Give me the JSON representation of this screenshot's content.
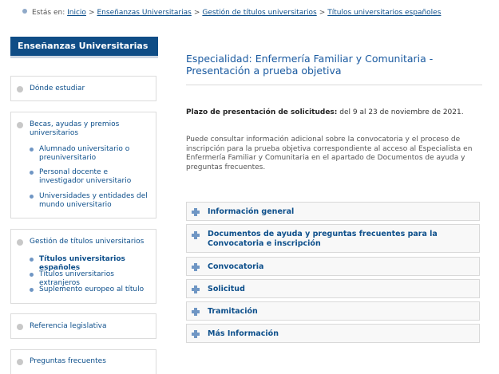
{
  "breadcrumb": {
    "prefix": "Estás en:",
    "items": [
      "Inicio",
      "Enseñanzas Universitarias",
      "Gestión de títulos universitarios",
      "Títulos universitarios españoles"
    ],
    "separator": ">"
  },
  "sidebar": {
    "title": "Enseñanzas Universitarias",
    "donde": "Dónde estudiar",
    "becas": {
      "label": "Becas, ayudas y premios universitarios",
      "subs": [
        "Alumnado universitario o preuniversitario",
        "Personal docente e investigador universitario",
        "Universidades y entidades del mundo universitario"
      ]
    },
    "gestion": {
      "label": "Gestión de títulos universitarios",
      "subs": [
        "Títulos universitarios españoles",
        "Títulos universitarios extranjeros",
        "Suplemento europeo al título"
      ]
    },
    "referencia": "Referencia legislativa",
    "preguntas": "Preguntas frecuentes"
  },
  "main": {
    "title": "Especialidad: Enfermería Familiar y Comunitaria - Presentación a prueba objetiva",
    "plazo_label": "Plazo de presentación de solicitudes:",
    "plazo_value": " del 9 al 23 de noviembre de 2021.",
    "info": "Puede consultar información adicional sobre la convocatoria y el proceso de inscripción para la prueba objetiva correspondiente al acceso al Especialista en Enfermería Familiar y Comunitaria en el apartado de Documentos de ayuda y preguntas frecuentes.",
    "sections": [
      "Información general",
      "Documentos de ayuda y preguntas frecuentes para la Convocatoria e inscripción",
      "Convocatoria",
      "Solicitud",
      "Tramitación",
      "Más Información"
    ]
  },
  "colors": {
    "header_bg": "#0f4d86",
    "link": "#0d4f8b",
    "title": "#1a5aa0",
    "accent_plus": "#6f96c4"
  },
  "icons": {
    "accordion": "plus-icon",
    "menu": "bullet-dot-icon"
  }
}
